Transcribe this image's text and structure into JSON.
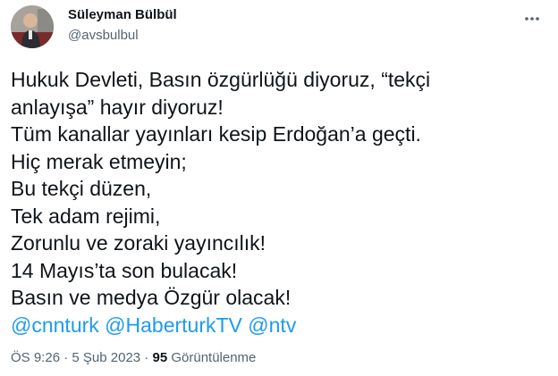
{
  "author": {
    "name": "Süleyman Bülbül",
    "handle": "@avsbulbul"
  },
  "tweet": {
    "lines": [
      "Hukuk Devleti, Basın özgürlüğü diyoruz, “tekçi",
      "anlayışa” hayır diyoruz!",
      "Tüm kanallar yayınları kesip Erdoğan’a geçti.",
      "Hiç merak etmeyin;",
      "Bu tekçi düzen,",
      "Tek adam rejimi,",
      "Zorunlu ve zoraki yayıncılık!",
      "14 Mayıs’ta son bulacak!",
      "Basın ve medya Özgür olacak!"
    ],
    "mentions": [
      "@cnnturk",
      "@HaberturkTV",
      "@ntv"
    ]
  },
  "meta": {
    "time": "ÖS 9:26",
    "separator": "·",
    "date": "5 Şub 2023",
    "views_count": "95",
    "views_label": "Görüntülenme"
  },
  "icons": {
    "more": "more-horizontal-icon"
  }
}
